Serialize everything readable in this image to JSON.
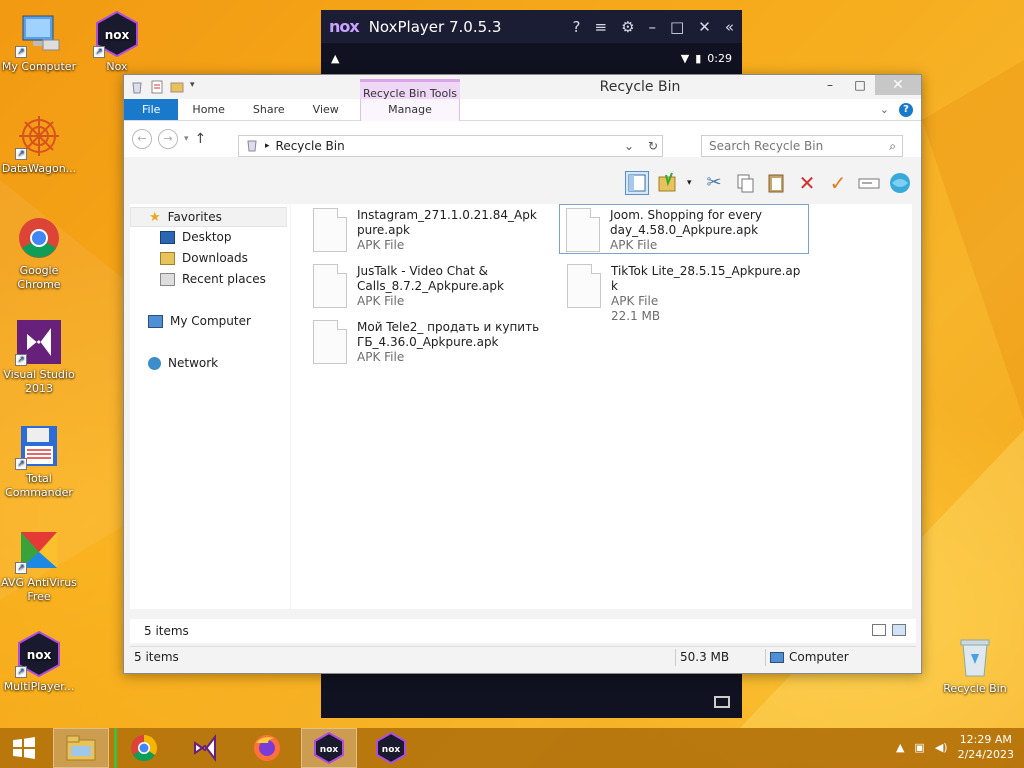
{
  "desktop": {
    "icons": [
      {
        "label": "My Computer",
        "icon": "computer-icon"
      },
      {
        "label": "Nox",
        "icon": "nox-icon"
      },
      {
        "label": "DataWagon...",
        "icon": "datawagon-icon"
      },
      {
        "label": "Google Chrome",
        "icon": "chrome-icon"
      },
      {
        "label": "Visual Studio 2013",
        "icon": "visual-studio-icon"
      },
      {
        "label": "Total Commander",
        "icon": "total-commander-icon"
      },
      {
        "label": "AVG AntiVirus Free",
        "icon": "avg-icon"
      },
      {
        "label": "MultiPlayer...",
        "icon": "multiplayer-icon"
      },
      {
        "label": "Recycle Bin",
        "icon": "recycle-bin-icon"
      }
    ]
  },
  "nox": {
    "logo": "nox",
    "title": "NoxPlayer 7.0.5.3",
    "time": "0:29",
    "alert": "▲"
  },
  "explorer": {
    "title": "Recycle Bin",
    "context_tab": "Recycle Bin Tools",
    "ribbon_tabs": [
      "File",
      "Home",
      "Share",
      "View",
      "Manage"
    ],
    "address": "Recycle Bin",
    "search_placeholder": "Search Recycle Bin",
    "nav": {
      "favorites": "Favorites",
      "desktop": "Desktop",
      "downloads": "Downloads",
      "recent": "Recent places",
      "computer": "My Computer",
      "network": "Network"
    },
    "files": [
      {
        "name": "Instagram_271.1.0.21.84_Apkpure.apk",
        "type": "APK File"
      },
      {
        "name": "Joom. Shopping for every day_4.58.0_Apkpure.apk",
        "type": "APK File"
      },
      {
        "name": "JusTalk - Video Chat & Calls_8.7.2_Apkpure.apk",
        "type": "APK File"
      },
      {
        "name": "TikTok Lite_28.5.15_Apkpure.apk",
        "type": "APK File",
        "size": "22.1 MB"
      },
      {
        "name": "Мой Tele2_ продать и купить ГБ_4.36.0_Apkpure.apk",
        "type": "APK File"
      }
    ],
    "item_count": "5 items",
    "status": {
      "items": "5 items",
      "size": "50.3 MB",
      "location": "Computer"
    }
  },
  "taskbar": {
    "time": "12:29 AM",
    "date": "2/24/2023"
  },
  "colors": {
    "accent": "#1979ca",
    "desktop": "#f6ac1c",
    "context_tab": "#efd7f6"
  }
}
